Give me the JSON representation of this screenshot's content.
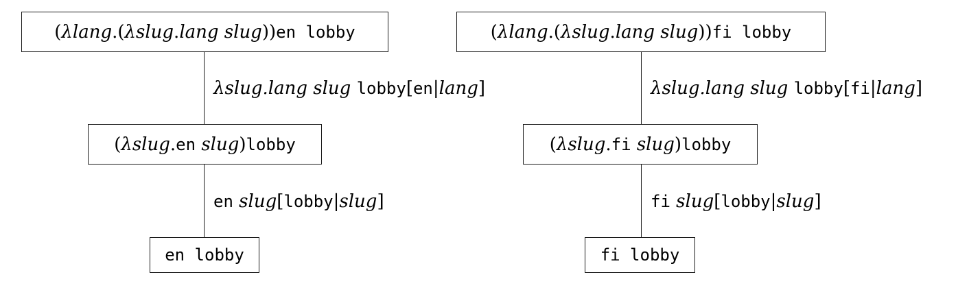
{
  "trees": [
    {
      "steps": [
        [
          {
            "style": "rm",
            "text": "("
          },
          {
            "style": "it",
            "text": "λlang"
          },
          {
            "style": "rm",
            "text": ".("
          },
          {
            "style": "it",
            "text": "λslug"
          },
          {
            "style": "rm",
            "text": "."
          },
          {
            "style": "it",
            "text": "lang slug"
          },
          {
            "style": "rm",
            "text": "))"
          },
          {
            "style": "tt",
            "text": "en lobby"
          }
        ],
        [
          {
            "style": "rm",
            "text": "("
          },
          {
            "style": "it",
            "text": "λslug"
          },
          {
            "style": "rm",
            "text": "."
          },
          {
            "style": "tt",
            "text": "en"
          },
          {
            "style": "rm",
            "text": " "
          },
          {
            "style": "it",
            "text": "slug"
          },
          {
            "style": "rm",
            "text": ")"
          },
          {
            "style": "tt",
            "text": "lobby"
          }
        ],
        [
          {
            "style": "tt",
            "text": "en lobby"
          }
        ]
      ],
      "edges": [
        [
          {
            "style": "it",
            "text": "λslug.lang slug"
          },
          {
            "style": "rm",
            "text": " "
          },
          {
            "style": "tt",
            "text": "lobby"
          },
          {
            "style": "rm",
            "text": "["
          },
          {
            "style": "tt",
            "text": "en"
          },
          {
            "style": "rm",
            "text": "|"
          },
          {
            "style": "it",
            "text": "lang"
          },
          {
            "style": "rm",
            "text": "]"
          }
        ],
        [
          {
            "style": "tt",
            "text": "en"
          },
          {
            "style": "rm",
            "text": " "
          },
          {
            "style": "it",
            "text": "slug"
          },
          {
            "style": "rm",
            "text": "["
          },
          {
            "style": "tt",
            "text": "lobby"
          },
          {
            "style": "rm",
            "text": "|"
          },
          {
            "style": "it",
            "text": "slug"
          },
          {
            "style": "rm",
            "text": "]"
          }
        ]
      ]
    },
    {
      "steps": [
        [
          {
            "style": "rm",
            "text": "("
          },
          {
            "style": "it",
            "text": "λlang"
          },
          {
            "style": "rm",
            "text": ".("
          },
          {
            "style": "it",
            "text": "λslug"
          },
          {
            "style": "rm",
            "text": "."
          },
          {
            "style": "it",
            "text": "lang slug"
          },
          {
            "style": "rm",
            "text": "))"
          },
          {
            "style": "tt",
            "text": "fi lobby"
          }
        ],
        [
          {
            "style": "rm",
            "text": "("
          },
          {
            "style": "it",
            "text": "λslug"
          },
          {
            "style": "rm",
            "text": "."
          },
          {
            "style": "tt",
            "text": "fi"
          },
          {
            "style": "rm",
            "text": " "
          },
          {
            "style": "it",
            "text": "slug"
          },
          {
            "style": "rm",
            "text": ")"
          },
          {
            "style": "tt",
            "text": "lobby"
          }
        ],
        [
          {
            "style": "tt",
            "text": "fi lobby"
          }
        ]
      ],
      "edges": [
        [
          {
            "style": "it",
            "text": "λslug.lang slug"
          },
          {
            "style": "rm",
            "text": " "
          },
          {
            "style": "tt",
            "text": "lobby"
          },
          {
            "style": "rm",
            "text": "["
          },
          {
            "style": "tt",
            "text": "fi"
          },
          {
            "style": "rm",
            "text": "|"
          },
          {
            "style": "it",
            "text": "lang"
          },
          {
            "style": "rm",
            "text": "]"
          }
        ],
        [
          {
            "style": "tt",
            "text": "fi"
          },
          {
            "style": "rm",
            "text": " "
          },
          {
            "style": "it",
            "text": "slug"
          },
          {
            "style": "rm",
            "text": "["
          },
          {
            "style": "tt",
            "text": "lobby"
          },
          {
            "style": "rm",
            "text": "|"
          },
          {
            "style": "it",
            "text": "slug"
          },
          {
            "style": "rm",
            "text": "]"
          }
        ]
      ]
    }
  ]
}
